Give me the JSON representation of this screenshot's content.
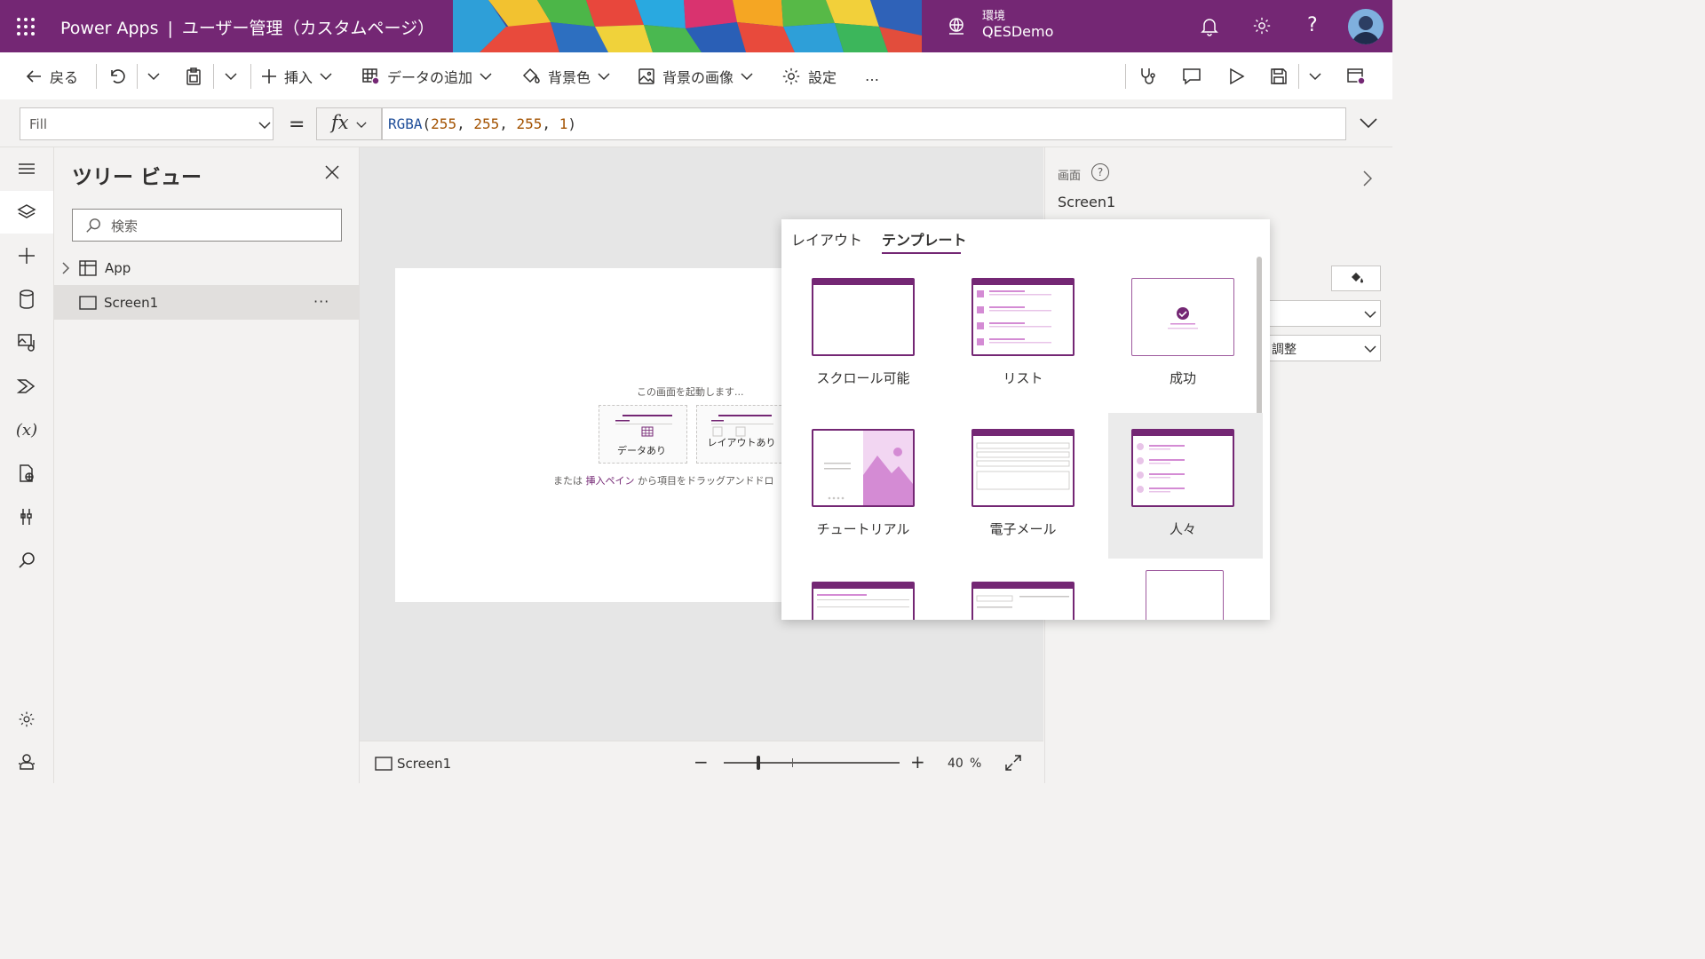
{
  "header": {
    "app_name": "Power Apps",
    "separator": "|",
    "page_title": "ユーザー管理（カスタムページ）",
    "env_label": "環境",
    "env_name": "QESDemo"
  },
  "command_bar": {
    "back": "戻る",
    "insert": "挿入",
    "add_data": "データの追加",
    "background_color": "背景色",
    "background_image": "背景の画像",
    "settings": "設定",
    "more": "…"
  },
  "formula_bar": {
    "property": "Fill",
    "equals": "=",
    "fx": "fx",
    "formula": {
      "fn": "RGBA",
      "args": [
        "255",
        "255",
        "255",
        "1"
      ]
    }
  },
  "tree_view": {
    "title": "ツリー ビュー",
    "search_placeholder": "検索",
    "items": [
      {
        "label": "App"
      },
      {
        "label": "Screen1"
      }
    ],
    "more": "···"
  },
  "canvas": {
    "start_text": "この画面を起動します...",
    "option_with_data": "データあり",
    "option_with_layout": "レイアウトあり",
    "hint_prefix": "または",
    "hint_link": "挿入ペイン",
    "hint_suffix": "から項目をドラッグアンドドロ"
  },
  "status_bar": {
    "screen_name": "Screen1",
    "zoom_value": "40",
    "zoom_unit": "%",
    "zoom_minus": "−",
    "zoom_plus": "+"
  },
  "properties_panel": {
    "label": "画面",
    "help": "?",
    "screen_name": "Screen1",
    "dropdown2_value": "調整"
  },
  "popup": {
    "tabs": [
      {
        "label": "レイアウト",
        "active": false
      },
      {
        "label": "テンプレート",
        "active": true
      }
    ],
    "templates": [
      {
        "label": "スクロール可能"
      },
      {
        "label": "リスト"
      },
      {
        "label": "成功"
      },
      {
        "label": "チュートリアル"
      },
      {
        "label": "電子メール"
      },
      {
        "label": "人々",
        "selected": true
      }
    ]
  },
  "colors": {
    "brand": "#742774",
    "accent_light": "#d48bd4",
    "link": "#742774"
  }
}
